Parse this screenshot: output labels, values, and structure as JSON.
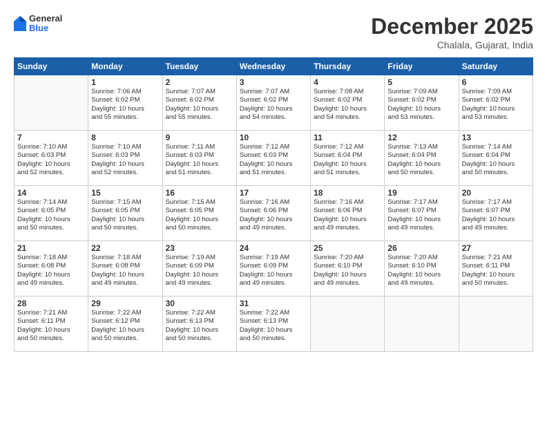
{
  "header": {
    "logo": {
      "general": "General",
      "blue": "Blue"
    },
    "title": "December 2025",
    "location": "Chalala, Gujarat, India"
  },
  "calendar": {
    "days_of_week": [
      "Sunday",
      "Monday",
      "Tuesday",
      "Wednesday",
      "Thursday",
      "Friday",
      "Saturday"
    ],
    "weeks": [
      [
        {
          "num": "",
          "info": ""
        },
        {
          "num": "1",
          "info": "Sunrise: 7:06 AM\nSunset: 6:02 PM\nDaylight: 10 hours\nand 55 minutes."
        },
        {
          "num": "2",
          "info": "Sunrise: 7:07 AM\nSunset: 6:02 PM\nDaylight: 10 hours\nand 55 minutes."
        },
        {
          "num": "3",
          "info": "Sunrise: 7:07 AM\nSunset: 6:02 PM\nDaylight: 10 hours\nand 54 minutes."
        },
        {
          "num": "4",
          "info": "Sunrise: 7:08 AM\nSunset: 6:02 PM\nDaylight: 10 hours\nand 54 minutes."
        },
        {
          "num": "5",
          "info": "Sunrise: 7:09 AM\nSunset: 6:02 PM\nDaylight: 10 hours\nand 53 minutes."
        },
        {
          "num": "6",
          "info": "Sunrise: 7:09 AM\nSunset: 6:02 PM\nDaylight: 10 hours\nand 53 minutes."
        }
      ],
      [
        {
          "num": "7",
          "info": "Sunrise: 7:10 AM\nSunset: 6:03 PM\nDaylight: 10 hours\nand 52 minutes."
        },
        {
          "num": "8",
          "info": "Sunrise: 7:10 AM\nSunset: 6:03 PM\nDaylight: 10 hours\nand 52 minutes."
        },
        {
          "num": "9",
          "info": "Sunrise: 7:11 AM\nSunset: 6:03 PM\nDaylight: 10 hours\nand 51 minutes."
        },
        {
          "num": "10",
          "info": "Sunrise: 7:12 AM\nSunset: 6:03 PM\nDaylight: 10 hours\nand 51 minutes."
        },
        {
          "num": "11",
          "info": "Sunrise: 7:12 AM\nSunset: 6:04 PM\nDaylight: 10 hours\nand 51 minutes."
        },
        {
          "num": "12",
          "info": "Sunrise: 7:13 AM\nSunset: 6:04 PM\nDaylight: 10 hours\nand 50 minutes."
        },
        {
          "num": "13",
          "info": "Sunrise: 7:14 AM\nSunset: 6:04 PM\nDaylight: 10 hours\nand 50 minutes."
        }
      ],
      [
        {
          "num": "14",
          "info": "Sunrise: 7:14 AM\nSunset: 6:05 PM\nDaylight: 10 hours\nand 50 minutes."
        },
        {
          "num": "15",
          "info": "Sunrise: 7:15 AM\nSunset: 6:05 PM\nDaylight: 10 hours\nand 50 minutes."
        },
        {
          "num": "16",
          "info": "Sunrise: 7:15 AM\nSunset: 6:05 PM\nDaylight: 10 hours\nand 50 minutes."
        },
        {
          "num": "17",
          "info": "Sunrise: 7:16 AM\nSunset: 6:06 PM\nDaylight: 10 hours\nand 49 minutes."
        },
        {
          "num": "18",
          "info": "Sunrise: 7:16 AM\nSunset: 6:06 PM\nDaylight: 10 hours\nand 49 minutes."
        },
        {
          "num": "19",
          "info": "Sunrise: 7:17 AM\nSunset: 6:07 PM\nDaylight: 10 hours\nand 49 minutes."
        },
        {
          "num": "20",
          "info": "Sunrise: 7:17 AM\nSunset: 6:07 PM\nDaylight: 10 hours\nand 49 minutes."
        }
      ],
      [
        {
          "num": "21",
          "info": "Sunrise: 7:18 AM\nSunset: 6:08 PM\nDaylight: 10 hours\nand 49 minutes."
        },
        {
          "num": "22",
          "info": "Sunrise: 7:18 AM\nSunset: 6:08 PM\nDaylight: 10 hours\nand 49 minutes."
        },
        {
          "num": "23",
          "info": "Sunrise: 7:19 AM\nSunset: 6:09 PM\nDaylight: 10 hours\nand 49 minutes."
        },
        {
          "num": "24",
          "info": "Sunrise: 7:19 AM\nSunset: 6:09 PM\nDaylight: 10 hours\nand 49 minutes."
        },
        {
          "num": "25",
          "info": "Sunrise: 7:20 AM\nSunset: 6:10 PM\nDaylight: 10 hours\nand 49 minutes."
        },
        {
          "num": "26",
          "info": "Sunrise: 7:20 AM\nSunset: 6:10 PM\nDaylight: 10 hours\nand 49 minutes."
        },
        {
          "num": "27",
          "info": "Sunrise: 7:21 AM\nSunset: 6:11 PM\nDaylight: 10 hours\nand 50 minutes."
        }
      ],
      [
        {
          "num": "28",
          "info": "Sunrise: 7:21 AM\nSunset: 6:11 PM\nDaylight: 10 hours\nand 50 minutes."
        },
        {
          "num": "29",
          "info": "Sunrise: 7:22 AM\nSunset: 6:12 PM\nDaylight: 10 hours\nand 50 minutes."
        },
        {
          "num": "30",
          "info": "Sunrise: 7:22 AM\nSunset: 6:13 PM\nDaylight: 10 hours\nand 50 minutes."
        },
        {
          "num": "31",
          "info": "Sunrise: 7:22 AM\nSunset: 6:13 PM\nDaylight: 10 hours\nand 50 minutes."
        },
        {
          "num": "",
          "info": ""
        },
        {
          "num": "",
          "info": ""
        },
        {
          "num": "",
          "info": ""
        }
      ]
    ]
  }
}
